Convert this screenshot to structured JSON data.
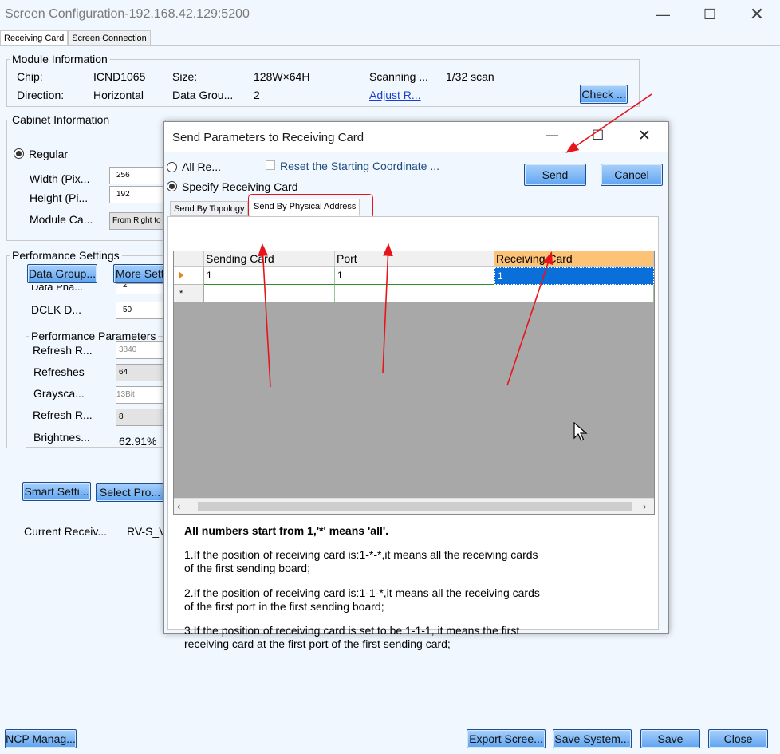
{
  "window": {
    "title": "Screen Configuration-192.168.42.129:5200"
  },
  "tabs": [
    "Receiving Card",
    "Screen Connection"
  ],
  "module": {
    "group_label": "Module Information",
    "chip_label": "Chip:",
    "chip_value": "ICND1065",
    "size_label": "Size:",
    "size_value": "128W×64H",
    "scanning_label": "Scanning ...",
    "scanning_value": "1/32 scan",
    "direction_label": "Direction:",
    "direction_value": "Horizontal",
    "data_group_label": "Data Grou...",
    "data_group_value": "2",
    "adjust_link": "Adjust R...",
    "check_button": "Check ..."
  },
  "cabinet": {
    "group_label": "Cabinet Information",
    "regular_label": "Regular",
    "width_label": "Width (Pix...",
    "width_value": "256",
    "height_label": "Height (Pi...",
    "height_value": "192",
    "module_cascade_label": "Module Ca...",
    "module_cascade_value": "From Right to"
  },
  "performance": {
    "group_label": "Performance Settings",
    "data_group_button": "Data Group...",
    "more_settings_button": "More Setti",
    "data_phase_label": "Data Pha...",
    "data_phase_value": "2",
    "dclk_label": "DCLK D...",
    "dclk_value": "50",
    "params_label": "Performance Parameters",
    "refresh_rate_label": "Refresh R...",
    "refresh_rate_value": "3840",
    "refreshes_label": "Refreshes",
    "refreshes_value": "64",
    "grayscale_label": "Graysca...",
    "grayscale_value": "13Bit",
    "refresh_r2_label": "Refresh R...",
    "refresh_r2_value": "8",
    "brightness_label": "Brightnes...",
    "brightness_value": "62.91%"
  },
  "lower": {
    "smart_settings_button": "Smart Setti...",
    "select_profile_button": "Select Pro...",
    "current_receiving_label": "Current Receiv...",
    "current_receiving_value": "RV-S_V"
  },
  "footer": {
    "ncp_button": "NCP Manag...",
    "export_button": "Export Scree...",
    "save_system_button": "Save System...",
    "save_button": "Save",
    "close_button": "Close"
  },
  "dialog": {
    "title": "Send Parameters to Receiving Card",
    "all_radio_label": "All Re...",
    "reset_checkbox_label": "Reset the Starting Coordinate ...",
    "specify_radio_label": "Specify Receiving Card",
    "send_button": "Send",
    "cancel_button": "Cancel",
    "subtabs": [
      "Send By Topology",
      "Send By Physical Address"
    ],
    "grid": {
      "columns": [
        "Sending Card",
        "Port",
        "Receiving Card"
      ],
      "rows": [
        [
          "1",
          "1",
          "1"
        ]
      ],
      "new_row_marker": "*"
    },
    "info": {
      "heading": "All numbers start from 1,'*' means 'all'.",
      "line1": "1.If the position of receiving card is:1-*-*,it means all the receiving cards of the first sending board;",
      "line2": "2.If the position of receiving card is:1-1-*,it means all the receiving cards of the first port in the first sending board;",
      "line3": "3.If the position of receiving card is set to be 1-1-1, it means the first receiving card at the first port of the first sending card;"
    }
  },
  "colors": {
    "accent_blue": "#5ea4f1",
    "selected_cell": "#0a6fd8",
    "header_highlight": "#fcc276",
    "annotation_red": "#e8141c"
  }
}
